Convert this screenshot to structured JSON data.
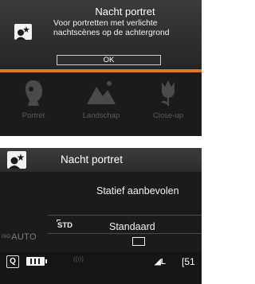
{
  "colors": {
    "accent": "#e07a1e",
    "screen_bg": "#1b1b1b",
    "dimmed_text": "#5a5a5a"
  },
  "mode_help": {
    "icon": "night-portrait-icon",
    "title": "Nacht portret",
    "description": "Voor portretten met verlichte nachtscènes op de achtergrond",
    "ok_label": "OK"
  },
  "scene_dial": [
    {
      "label": "Portret",
      "icon": "portrait-icon"
    },
    {
      "label": "Landschap",
      "icon": "landscape-icon"
    },
    {
      "label": "Close-up",
      "icon": "flower-icon"
    }
  ],
  "quick_control": {
    "mode_icon": "night-portrait-icon",
    "mode_name": "Nacht portret",
    "advice": "Statief aanbevolen",
    "iso_label": "AUTO",
    "iso_prefix": "ISO",
    "picture_style_code": "STD",
    "picture_style_label": "Standaard",
    "aspect_icon": "aspect-ratio-icon",
    "q_button": "Q",
    "battery_icon": "battery-full-icon",
    "wifi_icon": "wifi-off-icon",
    "wifi_text": "((ı))",
    "quality": "◢L",
    "shots_remaining": "[51"
  }
}
